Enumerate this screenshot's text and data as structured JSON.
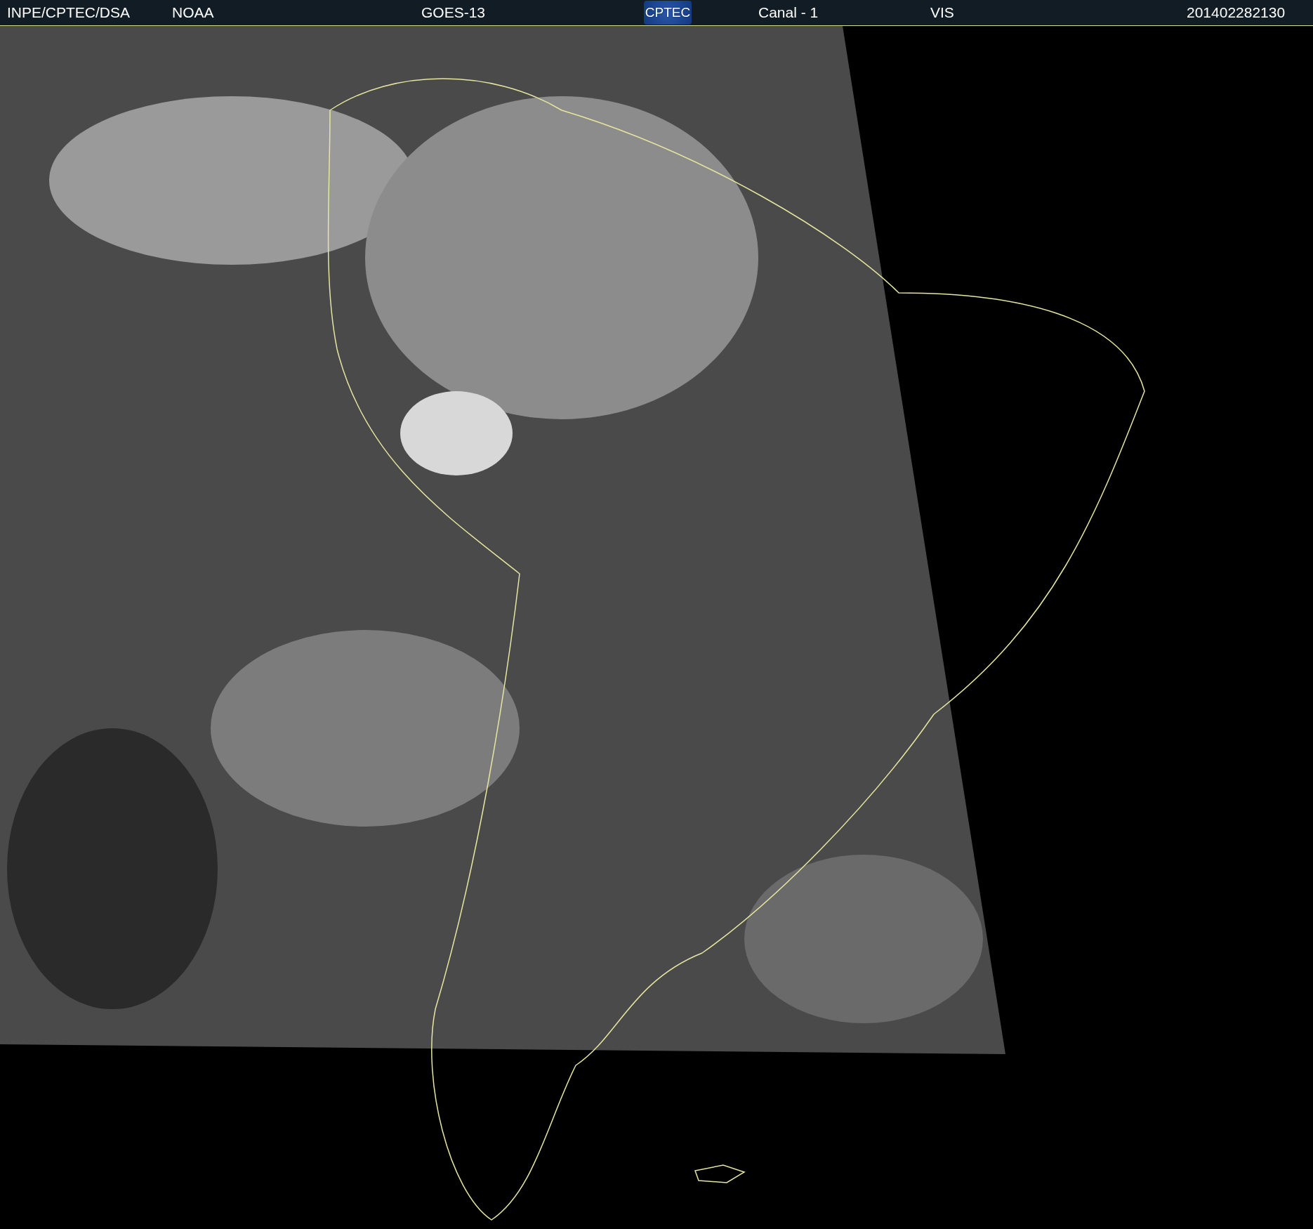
{
  "header": {
    "institution": "INPE/CPTEC/DSA",
    "agency": "NOAA",
    "satellite": "GOES-13",
    "logo": "CPTEC",
    "channel": "Canal - 1",
    "band": "VIS",
    "timestamp": "201402282130"
  }
}
